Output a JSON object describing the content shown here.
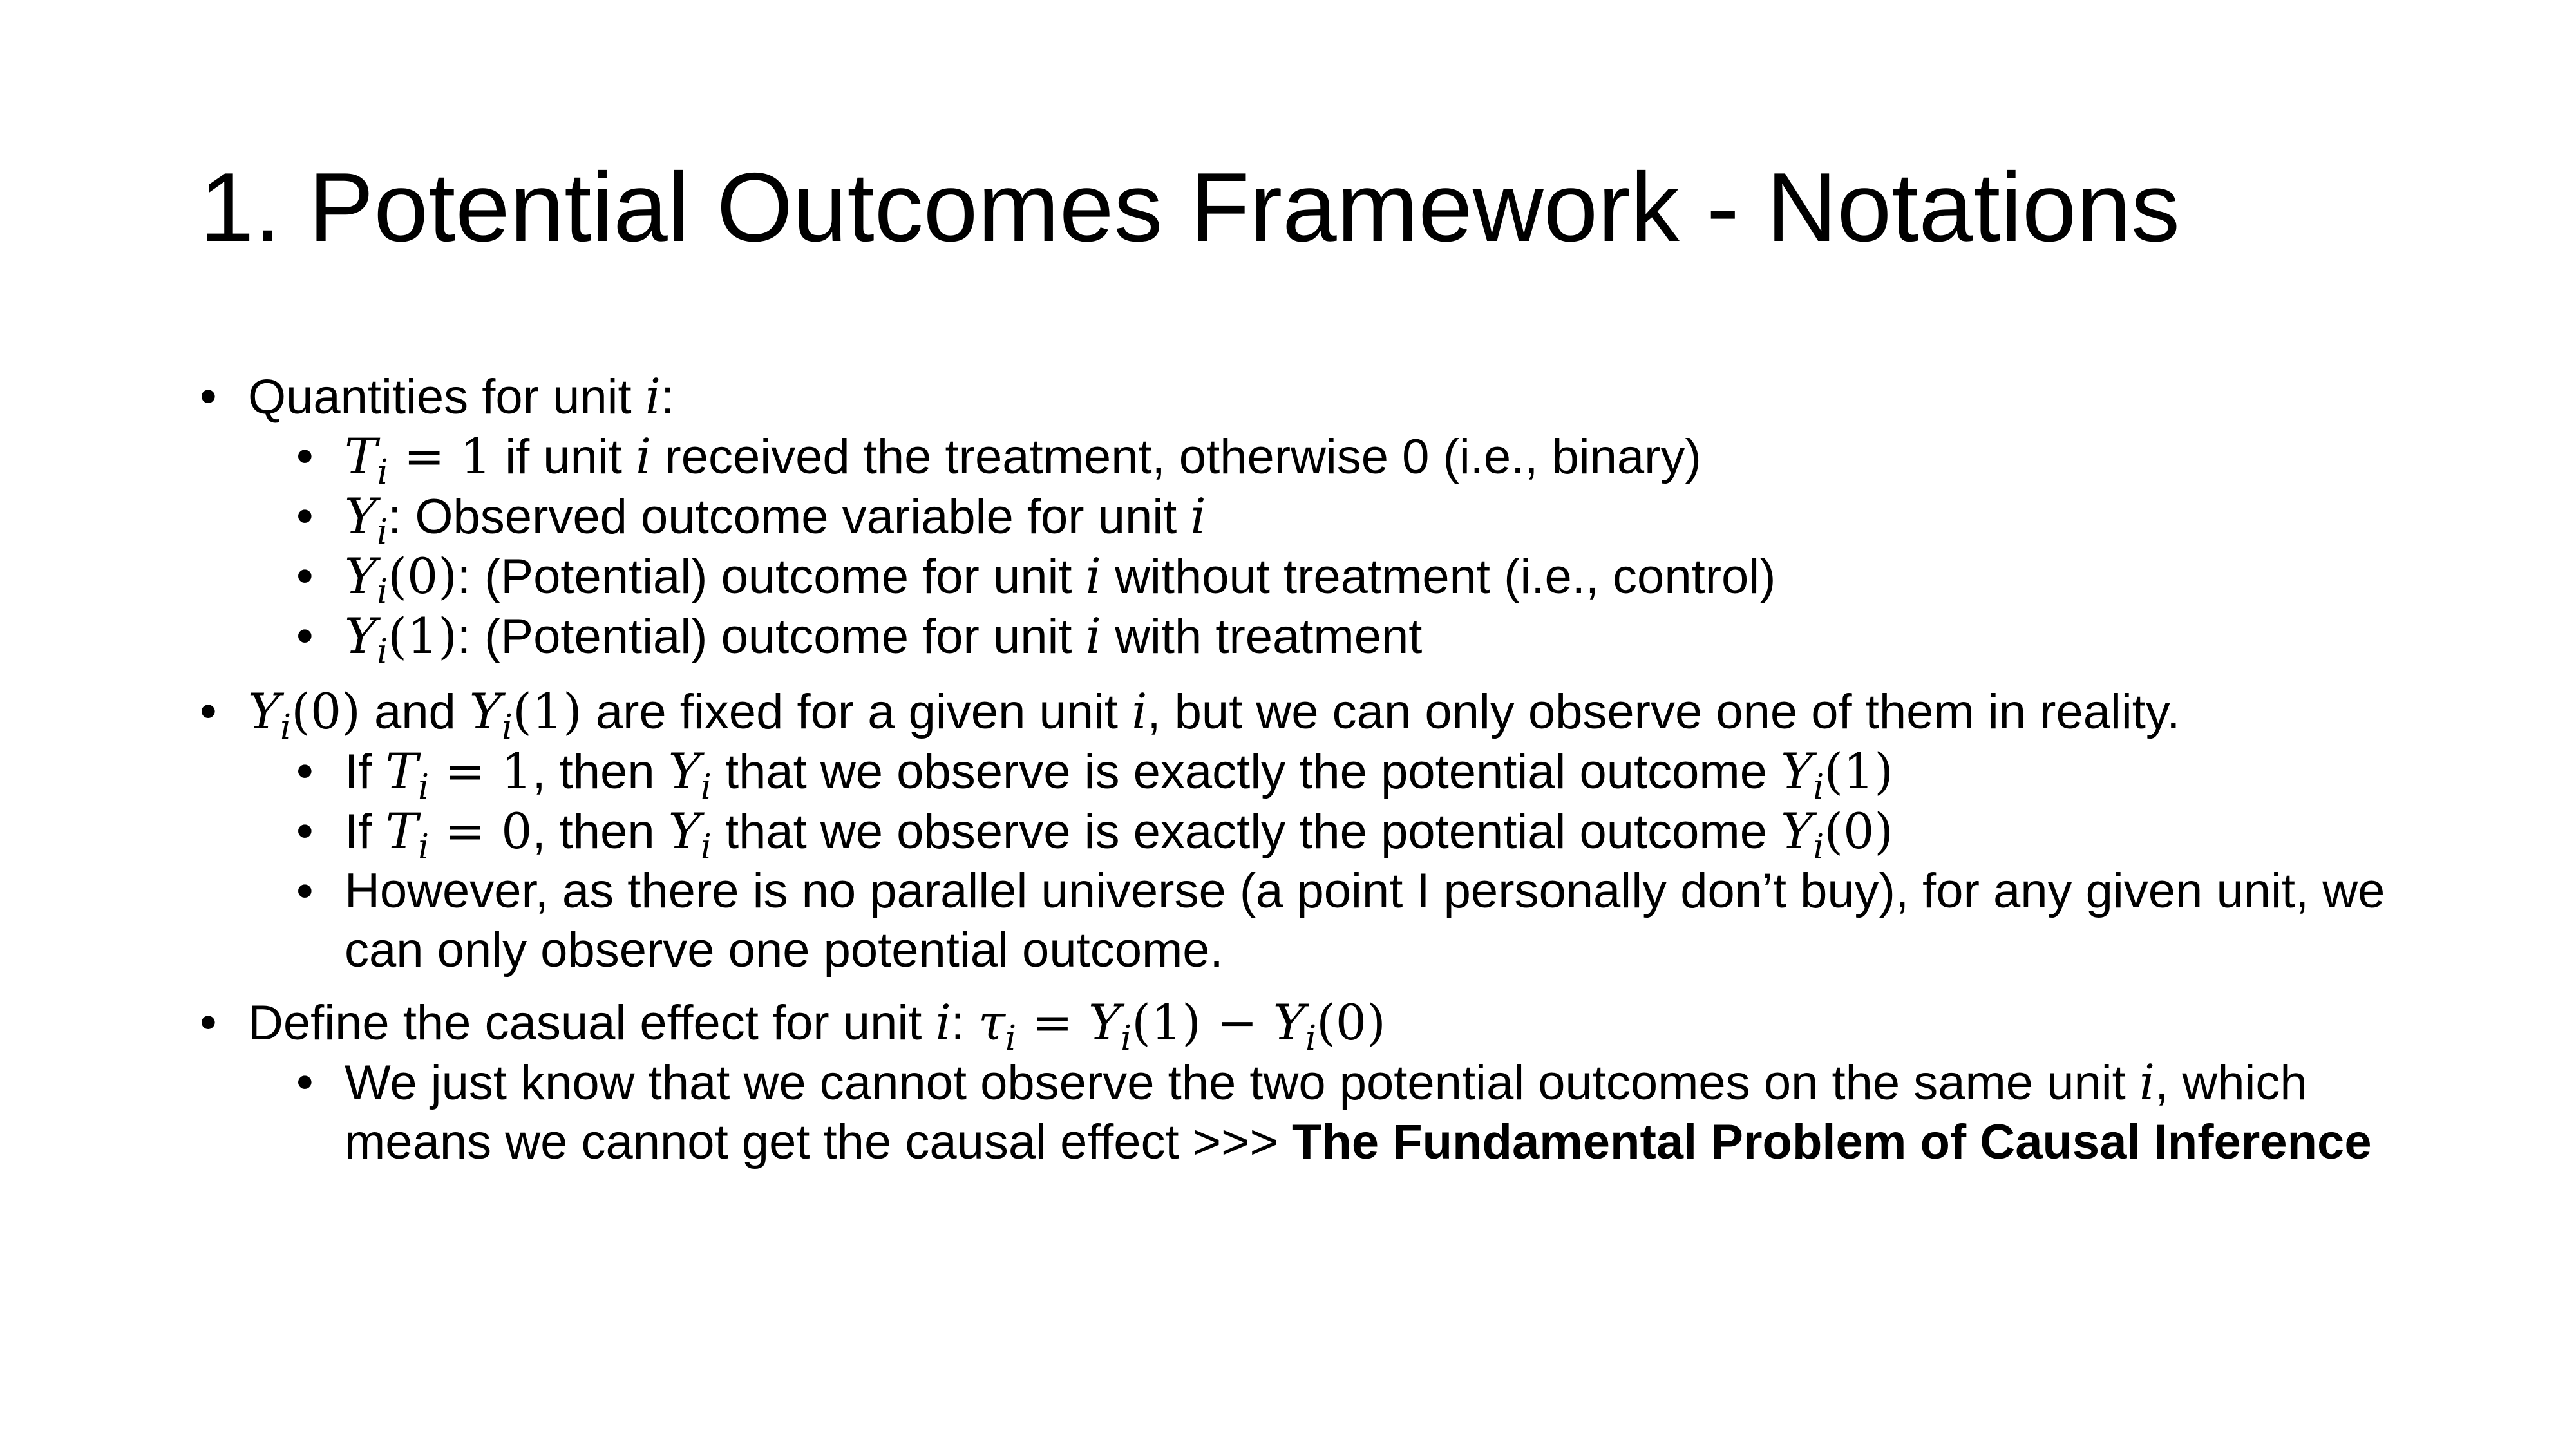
{
  "title": "1. Potential Outcomes Framework - Notations",
  "m": {
    "i": "i",
    "T": "T",
    "Y": "Y",
    "tau": "τ",
    "eq1": " = 1",
    "eq0": " = 0",
    "p0": "(0)",
    "p1": "(1)",
    "eqsp": " = ",
    "minus": " − "
  },
  "s1": {
    "text": "Quantities for unit ",
    "colon": ":",
    "i1": {
      "a": " if unit ",
      "b": " received the treatment, otherwise 0 (i.e., binary)"
    },
    "i2": {
      "a": ": Observed outcome variable for unit "
    },
    "i3": {
      "a": ": (Potential) outcome for unit ",
      "b": " without treatment (i.e., control)"
    },
    "i4": {
      "a": ": (Potential) outcome for unit ",
      "b": " with treatment"
    }
  },
  "s2": {
    "and": " and ",
    "rest": " are fixed for a given unit ",
    "rest2": ", but we can only observe one of them in reality.",
    "i1": {
      "if": "If ",
      "then": ", then ",
      "mid": " that we observe is exactly the potential outcome "
    },
    "i3": {
      "text": "However, as there is no parallel universe (a point I personally don’t buy), for any given unit, we can only observe one potential outcome."
    }
  },
  "s3": {
    "text": "Define the casual effect for unit ",
    "colon": ": ",
    "i1": {
      "a": "We just know that we cannot observe the two potential outcomes on the same unit ",
      "b": ", which means we cannot get the causal effect >>> ",
      "bold": "The Fundamental Problem of Causal Inference"
    }
  }
}
